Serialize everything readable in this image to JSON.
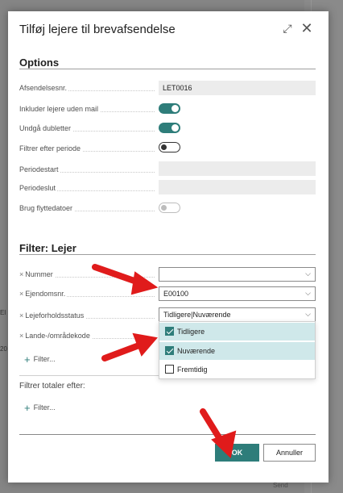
{
  "dialog": {
    "title": "Tilføj lejere til brevafsendelse",
    "expand_icon": "expand-icon",
    "close_icon": "close-icon"
  },
  "options": {
    "title": "Options",
    "fields": {
      "afsendelsesnr": {
        "label": "Afsendelsesnr.",
        "value": "LET0016"
      },
      "inkluder": {
        "label": "Inkluder lejere uden mail",
        "state": "on"
      },
      "undga": {
        "label": "Undgå dubletter",
        "state": "on"
      },
      "filtrer_periode": {
        "label": "Filtrer efter periode",
        "state": "off"
      },
      "periodestart": {
        "label": "Periodestart",
        "value": ""
      },
      "periodeslut": {
        "label": "Periodeslut",
        "value": ""
      },
      "brug_flytte": {
        "label": "Brug flyttedatoer",
        "state": "disabled"
      }
    }
  },
  "filter_lejer": {
    "title": "Filter: Lejer",
    "fields": {
      "nummer": {
        "label": "Nummer",
        "value": ""
      },
      "ejendomsnr": {
        "label": "Ejendomsnr.",
        "value": "E00100"
      },
      "lejeforholdsstatus": {
        "label": "Lejeforholdsstatus",
        "value": "Tidligere|Nuværende"
      },
      "lande": {
        "label": "Lande-/områdekode"
      }
    },
    "add_filter": "Filter..."
  },
  "dropdown": {
    "items": [
      {
        "label": "Tidligere",
        "checked": true
      },
      {
        "label": "Nuværende",
        "checked": true
      },
      {
        "label": "Fremtidig",
        "checked": false
      }
    ]
  },
  "totals": {
    "label": "Filtrer totaler efter:",
    "add_filter": "Filter..."
  },
  "buttons": {
    "ok": "OK",
    "cancel": "Annuller"
  },
  "background": {
    "send": "Send",
    "left_text_1": "El",
    "left_text_2": "20"
  },
  "colors": {
    "accent": "#2e7d7a",
    "annotation_arrow": "#e01b1b"
  }
}
